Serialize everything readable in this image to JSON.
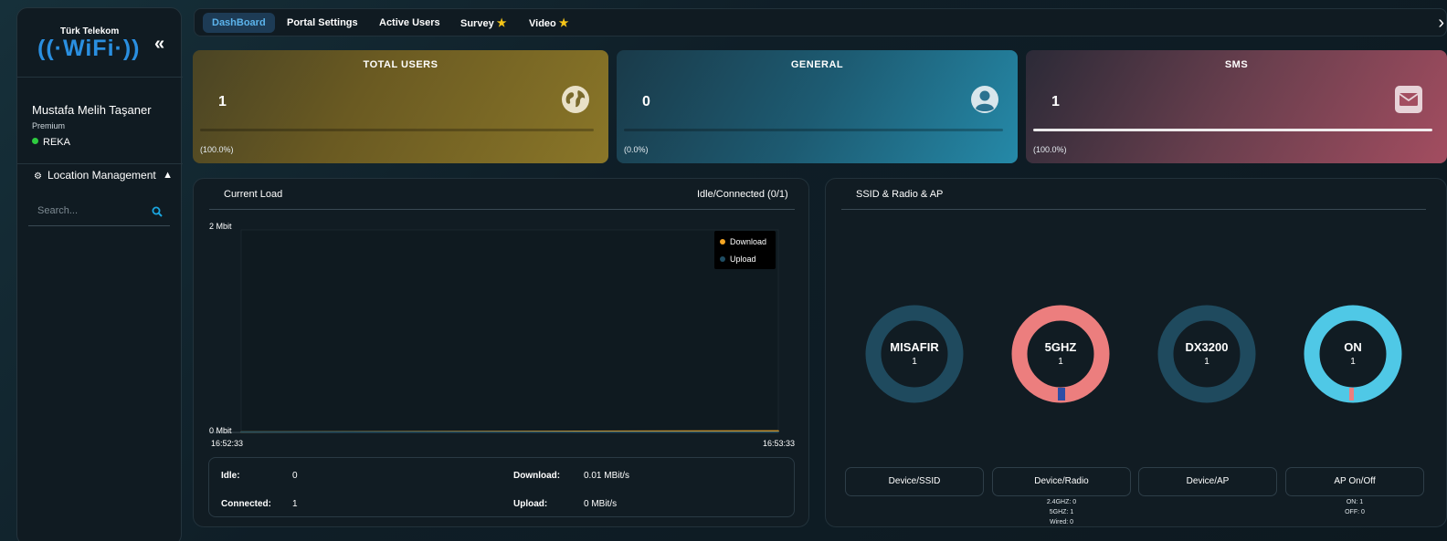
{
  "brand": {
    "top_text": "Türk Telekom",
    "wifi_text": "((·WiFi·))"
  },
  "sidebar": {
    "user_name": "Mustafa Melih Taşaner",
    "user_tier": "Premium",
    "location": "REKA",
    "location_status_color": "#2ecc40",
    "location_management_label": "Location Management",
    "search_placeholder": "Search..."
  },
  "tabs": [
    {
      "label": "DashBoard",
      "active": true
    },
    {
      "label": "Portal Settings",
      "active": false
    },
    {
      "label": "Active Users",
      "active": false
    },
    {
      "label": "Survey",
      "active": false,
      "star": "★"
    },
    {
      "label": "Video",
      "active": false,
      "star": "★"
    }
  ],
  "cards": {
    "total_users": {
      "title": "TOTAL USERS",
      "value": "1",
      "percent": "(100.0%)",
      "fill": 0,
      "icon": "globe-icon"
    },
    "general": {
      "title": "GENERAL",
      "value": "0",
      "percent": "(0.0%)",
      "fill": 0,
      "icon": "user-circle-icon"
    },
    "sms": {
      "title": "SMS",
      "value": "1",
      "percent": "(100.0%)",
      "fill": 1,
      "icon": "envelope-icon"
    }
  },
  "current_load": {
    "title": "Current Load",
    "status": "Idle/Connected (0/1)",
    "chart_data": {
      "type": "line",
      "x": [
        "16:52:33",
        "16:53:33"
      ],
      "ylim": [
        0,
        2
      ],
      "y_tick_labels": [
        "2 Mbit",
        "0 Mbit"
      ],
      "x_tick_labels": [
        "16:52:33",
        "16:53:33"
      ],
      "legend_placement": "top-right",
      "series": [
        {
          "name": "Download",
          "color": "#f5a623",
          "values": [
            0,
            0.01
          ]
        },
        {
          "name": "Upload",
          "color": "#1f4d63",
          "values": [
            0,
            0
          ]
        }
      ]
    },
    "stats": {
      "idle_label": "Idle:",
      "idle_value": "0",
      "connected_label": "Connected:",
      "connected_value": "1",
      "download_label": "Download:",
      "download_value": "0.01 MBit/s",
      "upload_label": "Upload:",
      "upload_value": "0 MBit/s"
    }
  },
  "ssid_panel": {
    "title": "SSID & Radio & AP",
    "donuts": [
      {
        "name": "MISAFIR",
        "count": "1",
        "ring_color": "#1f4a5e",
        "marker_color": ""
      },
      {
        "name": "5GHZ",
        "count": "1",
        "ring_color": "#ec7e7e",
        "marker_color": "#2d4ea6"
      },
      {
        "name": "DX3200",
        "count": "1",
        "ring_color": "#1f4a5e",
        "marker_color": ""
      },
      {
        "name": "ON",
        "count": "1",
        "ring_color": "#4fc8e6",
        "marker_color": "#ec7e7e"
      }
    ],
    "buttons": [
      {
        "label": "Device/SSID",
        "sub": []
      },
      {
        "label": "Device/Radio",
        "sub": [
          "2.4GHZ: 0",
          "5GHZ: 1",
          "Wired: 0"
        ]
      },
      {
        "label": "Device/AP",
        "sub": []
      },
      {
        "label": "AP On/Off",
        "sub": [
          "ON: 1",
          "OFF: 0"
        ]
      }
    ]
  }
}
